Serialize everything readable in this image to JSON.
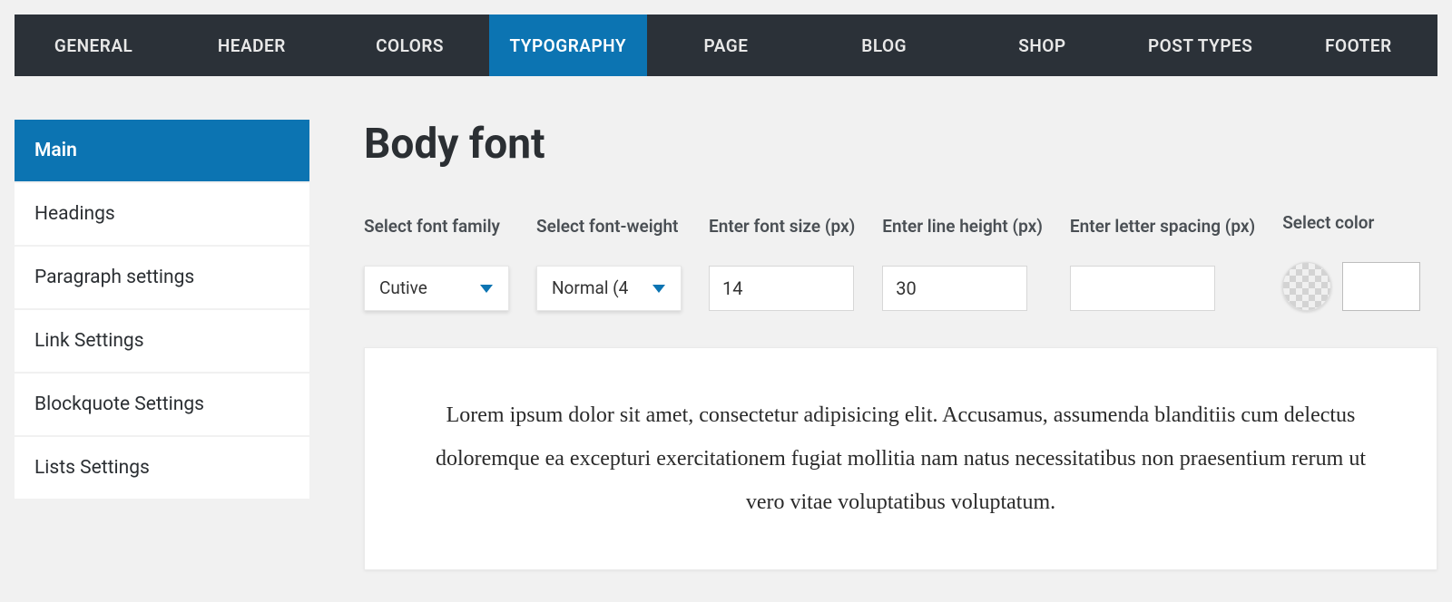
{
  "topnav": {
    "items": [
      {
        "label": "GENERAL"
      },
      {
        "label": "HEADER"
      },
      {
        "label": "COLORS"
      },
      {
        "label": "TYPOGRAPHY",
        "active": true
      },
      {
        "label": "PAGE"
      },
      {
        "label": "BLOG"
      },
      {
        "label": "SHOP"
      },
      {
        "label": "POST TYPES"
      },
      {
        "label": "FOOTER"
      }
    ]
  },
  "sidebar": {
    "items": [
      {
        "label": "Main",
        "active": true
      },
      {
        "label": "Headings"
      },
      {
        "label": "Paragraph settings"
      },
      {
        "label": "Link Settings"
      },
      {
        "label": "Blockquote Settings"
      },
      {
        "label": "Lists Settings"
      }
    ]
  },
  "page": {
    "title": "Body font"
  },
  "controls": {
    "font_family": {
      "label": "Select font family",
      "value": "Cutive"
    },
    "font_weight": {
      "label": "Select font-weight",
      "value": "Normal (4"
    },
    "font_size": {
      "label": "Enter font size (px)",
      "value": "14"
    },
    "line_height": {
      "label": "Enter line height (px)",
      "value": "30"
    },
    "letter_spacing": {
      "label": "Enter letter spacing (px)",
      "value": ""
    },
    "color": {
      "label": "Select color"
    }
  },
  "preview": {
    "text": "Lorem ipsum dolor sit amet, consectetur adipisicing elit. Accusamus, assumenda blanditiis cum delectus doloremque ea excepturi exercitationem fugiat mollitia nam natus necessitatibus non praesentium rerum ut vero vitae voluptatibus voluptatum."
  }
}
